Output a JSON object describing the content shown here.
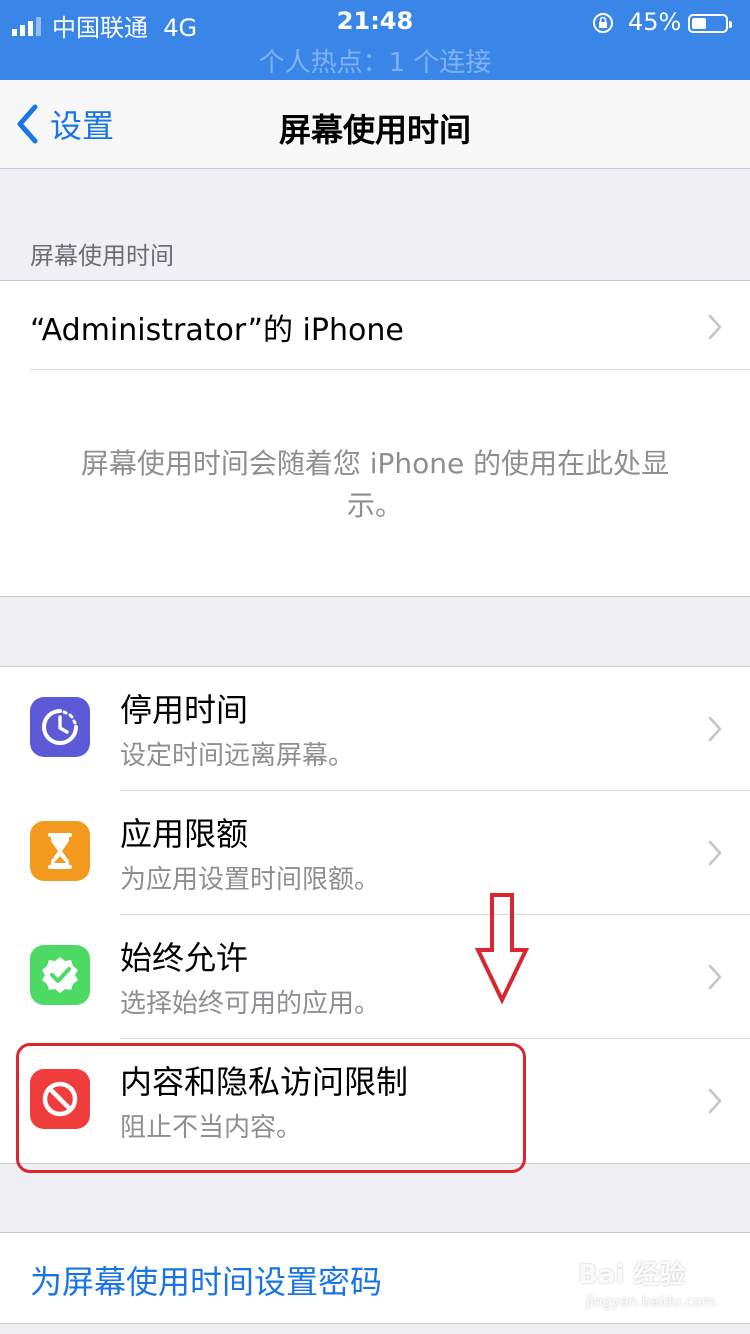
{
  "status_bar": {
    "carrier": "中国联通",
    "network": "4G",
    "time": "21:48",
    "battery": "45%",
    "battery_level": 0.45,
    "hotspot": "个人热点：1 个连接",
    "color": "#3a86e8"
  },
  "nav": {
    "back_label": "设置",
    "title": "屏幕使用时间"
  },
  "section_header": "屏幕使用时间",
  "device": {
    "name": "“Administrator”的 iPhone",
    "empty_text": "屏幕使用时间会随着您 iPhone 的使用在此处显示。"
  },
  "features": [
    {
      "title": "停用时间",
      "subtitle": "设定时间远离屏幕。",
      "icon": "downtime-icon",
      "color": "#5c5ad6"
    },
    {
      "title": "应用限额",
      "subtitle": "为应用设置时间限额。",
      "icon": "hourglass-icon",
      "color": "#f39a1e"
    },
    {
      "title": "始终允许",
      "subtitle": "选择始终可用的应用。",
      "icon": "checkmark-badge-icon",
      "color": "#4cd964"
    },
    {
      "title": "内容和隐私访问限制",
      "subtitle": "阻止不当内容。",
      "icon": "restriction-icon",
      "color": "#f03c3a"
    }
  ],
  "passcode_label": "为屏幕使用时间设置密码",
  "watermark": {
    "brand": "Bai 经验",
    "url": "jingyan.baidu.com"
  },
  "accent_color": "#1a74e6"
}
